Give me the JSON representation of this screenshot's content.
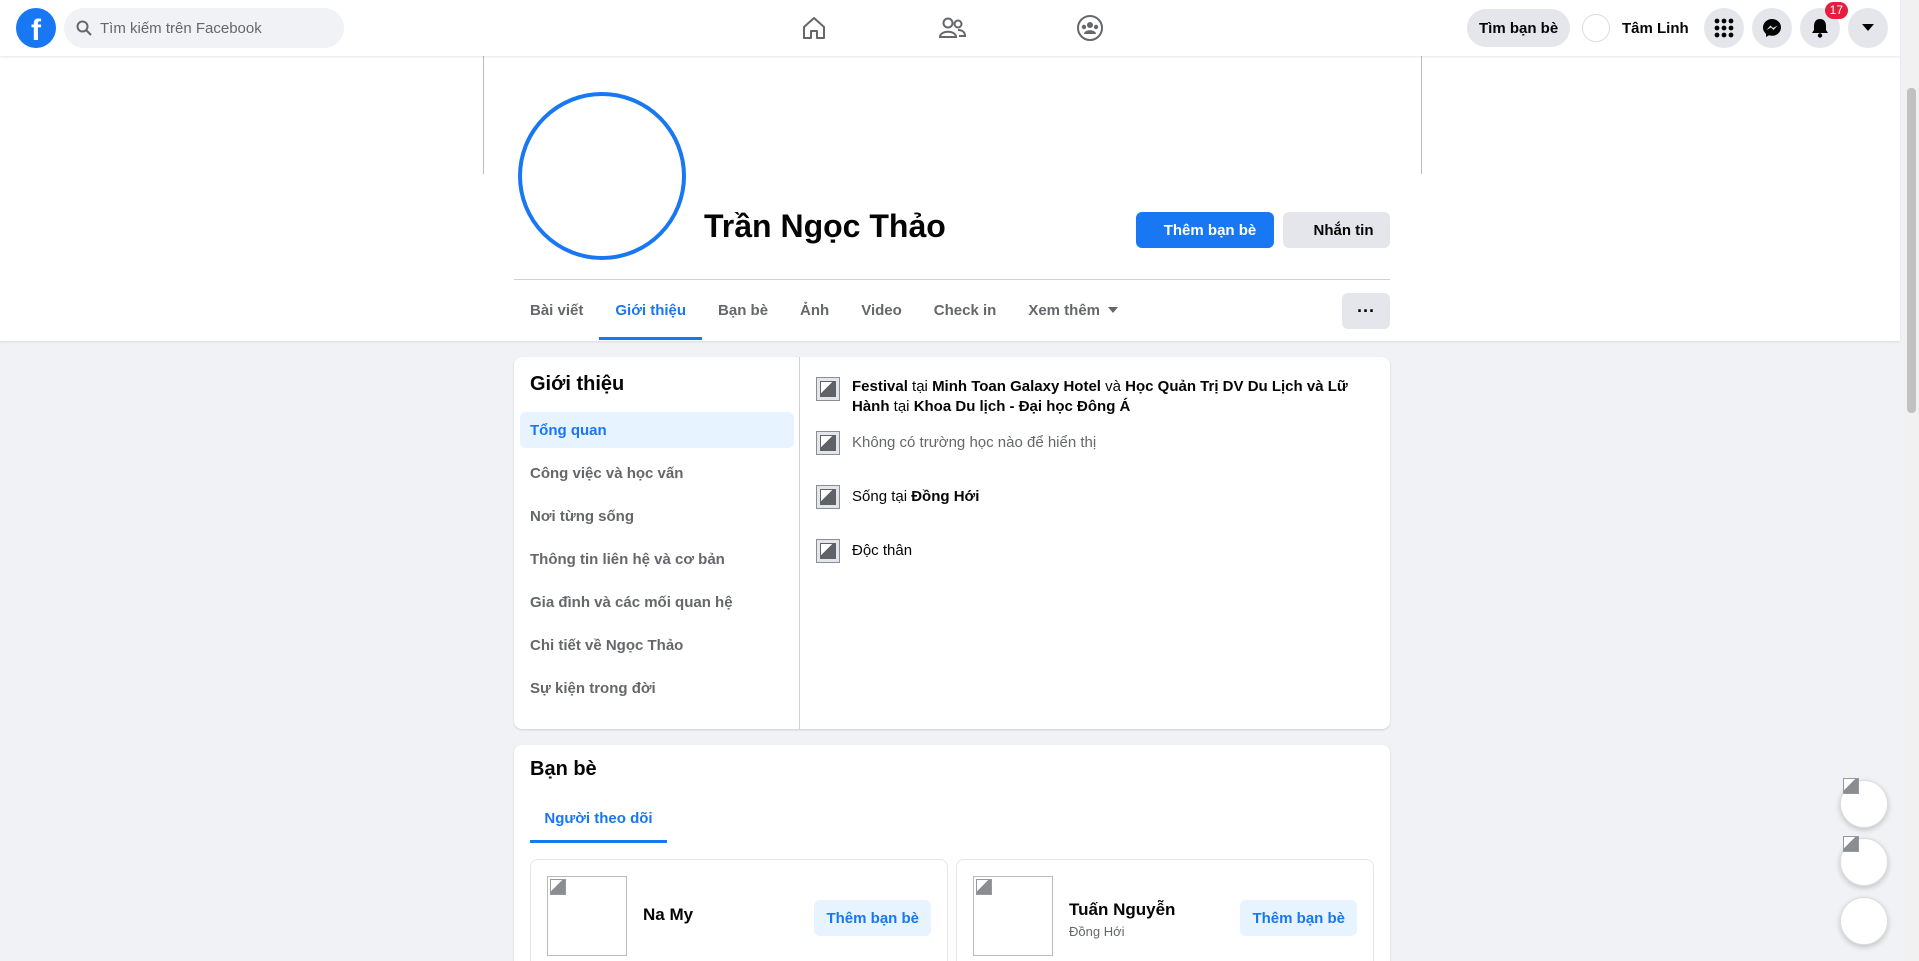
{
  "topbar": {
    "search_placeholder": "Tìm kiếm trên Facebook",
    "find_friends": "Tìm bạn bè",
    "user_name": "Tâm Linh",
    "notification_count": "17",
    "icons": [
      "facebook-logo",
      "home-icon",
      "friends-icon",
      "groups-icon",
      "menu-grid-icon",
      "messenger-icon",
      "bell-icon",
      "caret-down-icon"
    ]
  },
  "profile": {
    "name": "Trần Ngọc Thảo",
    "add_friend": "Thêm bạn bè",
    "message": "Nhắn tin",
    "tabs": [
      {
        "label": "Bài viết"
      },
      {
        "label": "Giới thiệu"
      },
      {
        "label": "Bạn bè"
      },
      {
        "label": "Ảnh"
      },
      {
        "label": "Video"
      },
      {
        "label": "Check in"
      },
      {
        "label": "Xem thêm"
      }
    ],
    "more_button": "···"
  },
  "about": {
    "title": "Giới thiệu",
    "menu": [
      "Tổng quan",
      "Công việc và học vấn",
      "Nơi từng sống",
      "Thông tin liên hệ và cơ bản",
      "Gia đình và các mối quan hệ",
      "Chi tiết về Ngọc Thảo",
      "Sự kiện trong đời"
    ],
    "work": {
      "role": "Festival",
      "at1": "tại",
      "company": "Minh Toan Galaxy Hotel",
      "and": "và",
      "role2": "Học Quản Trị DV Du Lịch và Lữ Hành",
      "at2": "tại",
      "company2": "Khoa Du lịch - Đại học Đông Á"
    },
    "school": "Không có trường học nào để hiển thị",
    "lives_prefix": "Sống tại",
    "lives_city": "Đồng Hới",
    "relationship": "Độc thân"
  },
  "friends": {
    "title": "Bạn bè",
    "tab": "Người theo dõi",
    "items": [
      {
        "name": "Na My",
        "sub": "",
        "button": "Thêm bạn bè"
      },
      {
        "name": "Tuấn Nguyễn",
        "sub": "Đồng Hới",
        "button": "Thêm bạn bè"
      }
    ]
  },
  "colors": {
    "accent": "#1877f2",
    "badge": "#e41e3f",
    "background": "#f0f2f5"
  }
}
